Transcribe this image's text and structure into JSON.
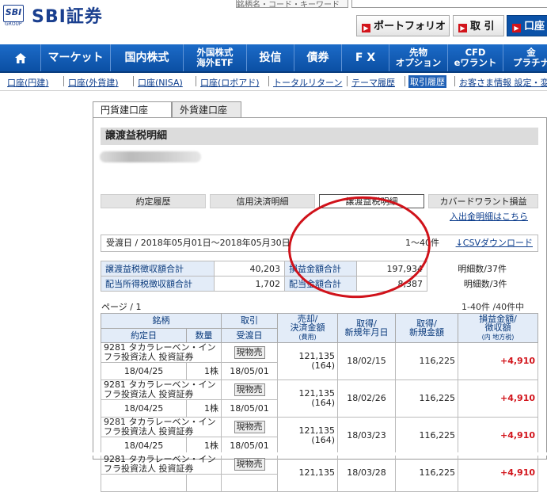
{
  "header": {
    "logo_small": "SBI",
    "logo_group": "GROUP",
    "logo_text": "SBI証券",
    "top_input_text": "銘柄名・コード・キーワード",
    "buttons": {
      "portfolio": "ポートフォリオ",
      "torihiki": "取 引",
      "kouza": "口座"
    },
    "accent": "#0b52a8",
    "bullet_color": "#d2141b"
  },
  "nav": {
    "home_icon": "home-icon",
    "items": [
      "マーケット",
      "国内株式",
      "外国株式\n海外ETF",
      "投信",
      "債券",
      "F X",
      "先物\nオプション",
      "CFD\neワラント",
      "金\nプラチナ"
    ]
  },
  "subnav": {
    "items": [
      "口座(円建)",
      "口座(外貨建)",
      "口座(NISA)",
      "口座(ロボアド)",
      "トータルリターン",
      "テーマ履歴",
      "取引履歴",
      "お客さま情報 設定・変"
    ]
  },
  "tabs": {
    "yen": "円貨建口座",
    "foreign": "外貨建口座"
  },
  "section_title": "譲渡益税明細",
  "subtabs": [
    "約定履歴",
    "信用決済明細",
    "譲渡益税明細",
    "カバードワラント損益"
  ],
  "link_inout": "入出金明細はこちら",
  "date_range": "受渡日 / 2018年05月01日〜2018年05月30日",
  "page_count": "1〜40件",
  "csv_link": "CSVダウンロード",
  "summary": {
    "row1": [
      "譲渡益税徴収額合計",
      "40,203",
      "損益金額合計",
      "197,934",
      "明細数/37件"
    ],
    "row2": [
      "配当所得税徴収額合計",
      "1,702",
      "配当金額合計",
      "8,387",
      "明細数/3件"
    ]
  },
  "pager": "ページ / 1",
  "pager_right": "1-40件 /40件中",
  "table": {
    "headers": {
      "meigara": "銘柄",
      "yakujo": "約定日",
      "suryo": "数量",
      "torihiki": "取引",
      "ukewatashi": "受渡日",
      "baikyaku": "売却/\n決済金額",
      "baikyaku_sub": "(費用)",
      "shutoku_date": "取得/\n新規年月日",
      "shutoku_amount": "取得/\n新規金額",
      "soneki": "損益金額/\n徴収額",
      "soneki_sub": "(内 地方税)"
    },
    "rows": [
      {
        "name": "9281 タカラレーベン・インフラ投資法人 投資証券",
        "date": "18/04/25",
        "qty": "1株",
        "kind": "現物売",
        "settle": "18/05/01",
        "amount": "121,135",
        "fee": "(164)",
        "acq_date": "18/02/15",
        "acq_amount": "116,225",
        "pl": "+4,910"
      },
      {
        "name": "9281 タカラレーベン・インフラ投資法人 投資証券",
        "date": "18/04/25",
        "qty": "1株",
        "kind": "現物売",
        "settle": "18/05/01",
        "amount": "121,135",
        "fee": "(164)",
        "acq_date": "18/02/26",
        "acq_amount": "116,225",
        "pl": "+4,910"
      },
      {
        "name": "9281 タカラレーベン・インフラ投資法人 投資証券",
        "date": "18/04/25",
        "qty": "1株",
        "kind": "現物売",
        "settle": "18/05/01",
        "amount": "121,135",
        "fee": "(164)",
        "acq_date": "18/03/23",
        "acq_amount": "116,225",
        "pl": "+4,910"
      },
      {
        "name": "9281 タカラレーベン・インフラ投資法人 投資証券",
        "date": "",
        "qty": "",
        "kind": "現物売",
        "settle": "",
        "amount": "121,135",
        "fee": "",
        "acq_date": "18/03/28",
        "acq_amount": "116,225",
        "pl": "+4,910"
      }
    ]
  }
}
